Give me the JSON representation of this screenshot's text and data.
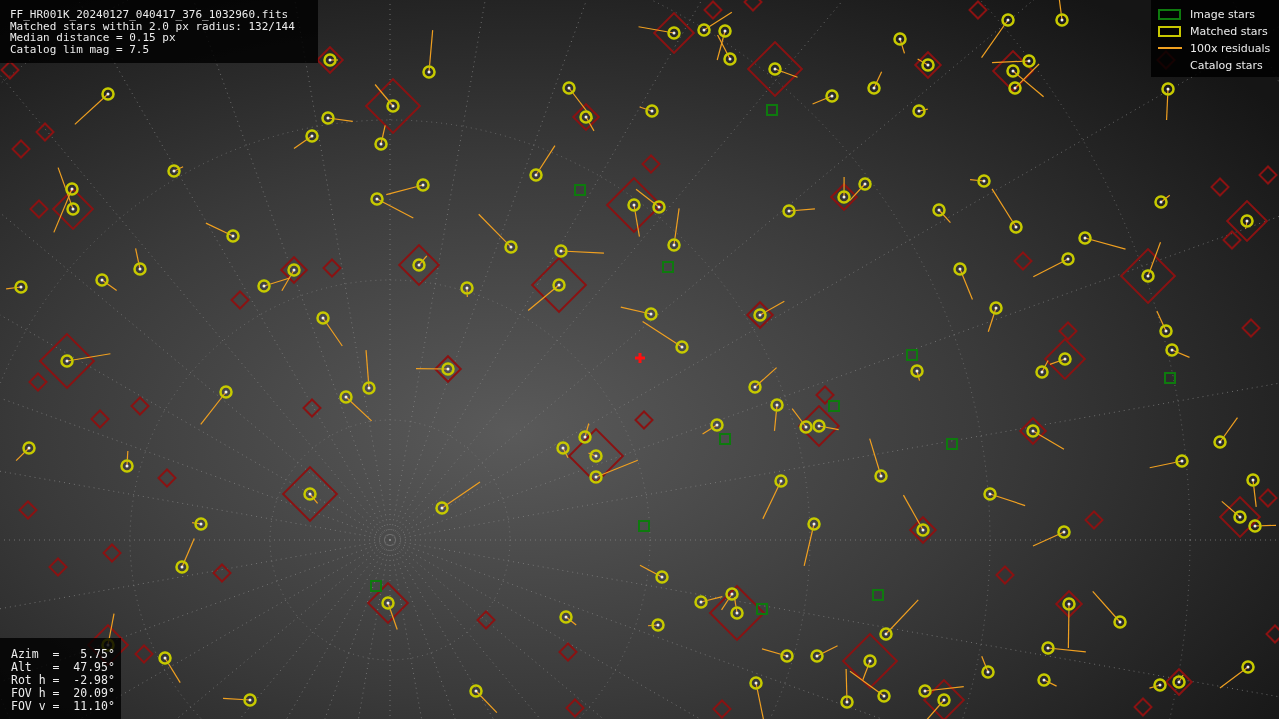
{
  "info": {
    "lines": [
      "FF_HR001K_20240127_040417_376_1032960.fits",
      "Matched stars within 2.0 px radius: 132/144",
      "Median distance = 0.15 px",
      "Catalog lim mag = 7.5"
    ]
  },
  "legend": {
    "items": [
      {
        "label": "Image stars",
        "kind": "image",
        "color": "#0e7a0e"
      },
      {
        "label": "Matched stars",
        "kind": "matched",
        "color": "#c8c800"
      },
      {
        "label": "100x residuals",
        "kind": "residual",
        "color": "#f0a020"
      },
      {
        "label": "Catalog stars",
        "kind": "catalog"
      }
    ]
  },
  "pointing": {
    "lines": [
      "Azim  =   5.75°",
      "Alt   =  47.95°",
      "Rot h =  -2.98°",
      "FOV h =  20.09°",
      "FOV v =  11.10°"
    ]
  }
}
